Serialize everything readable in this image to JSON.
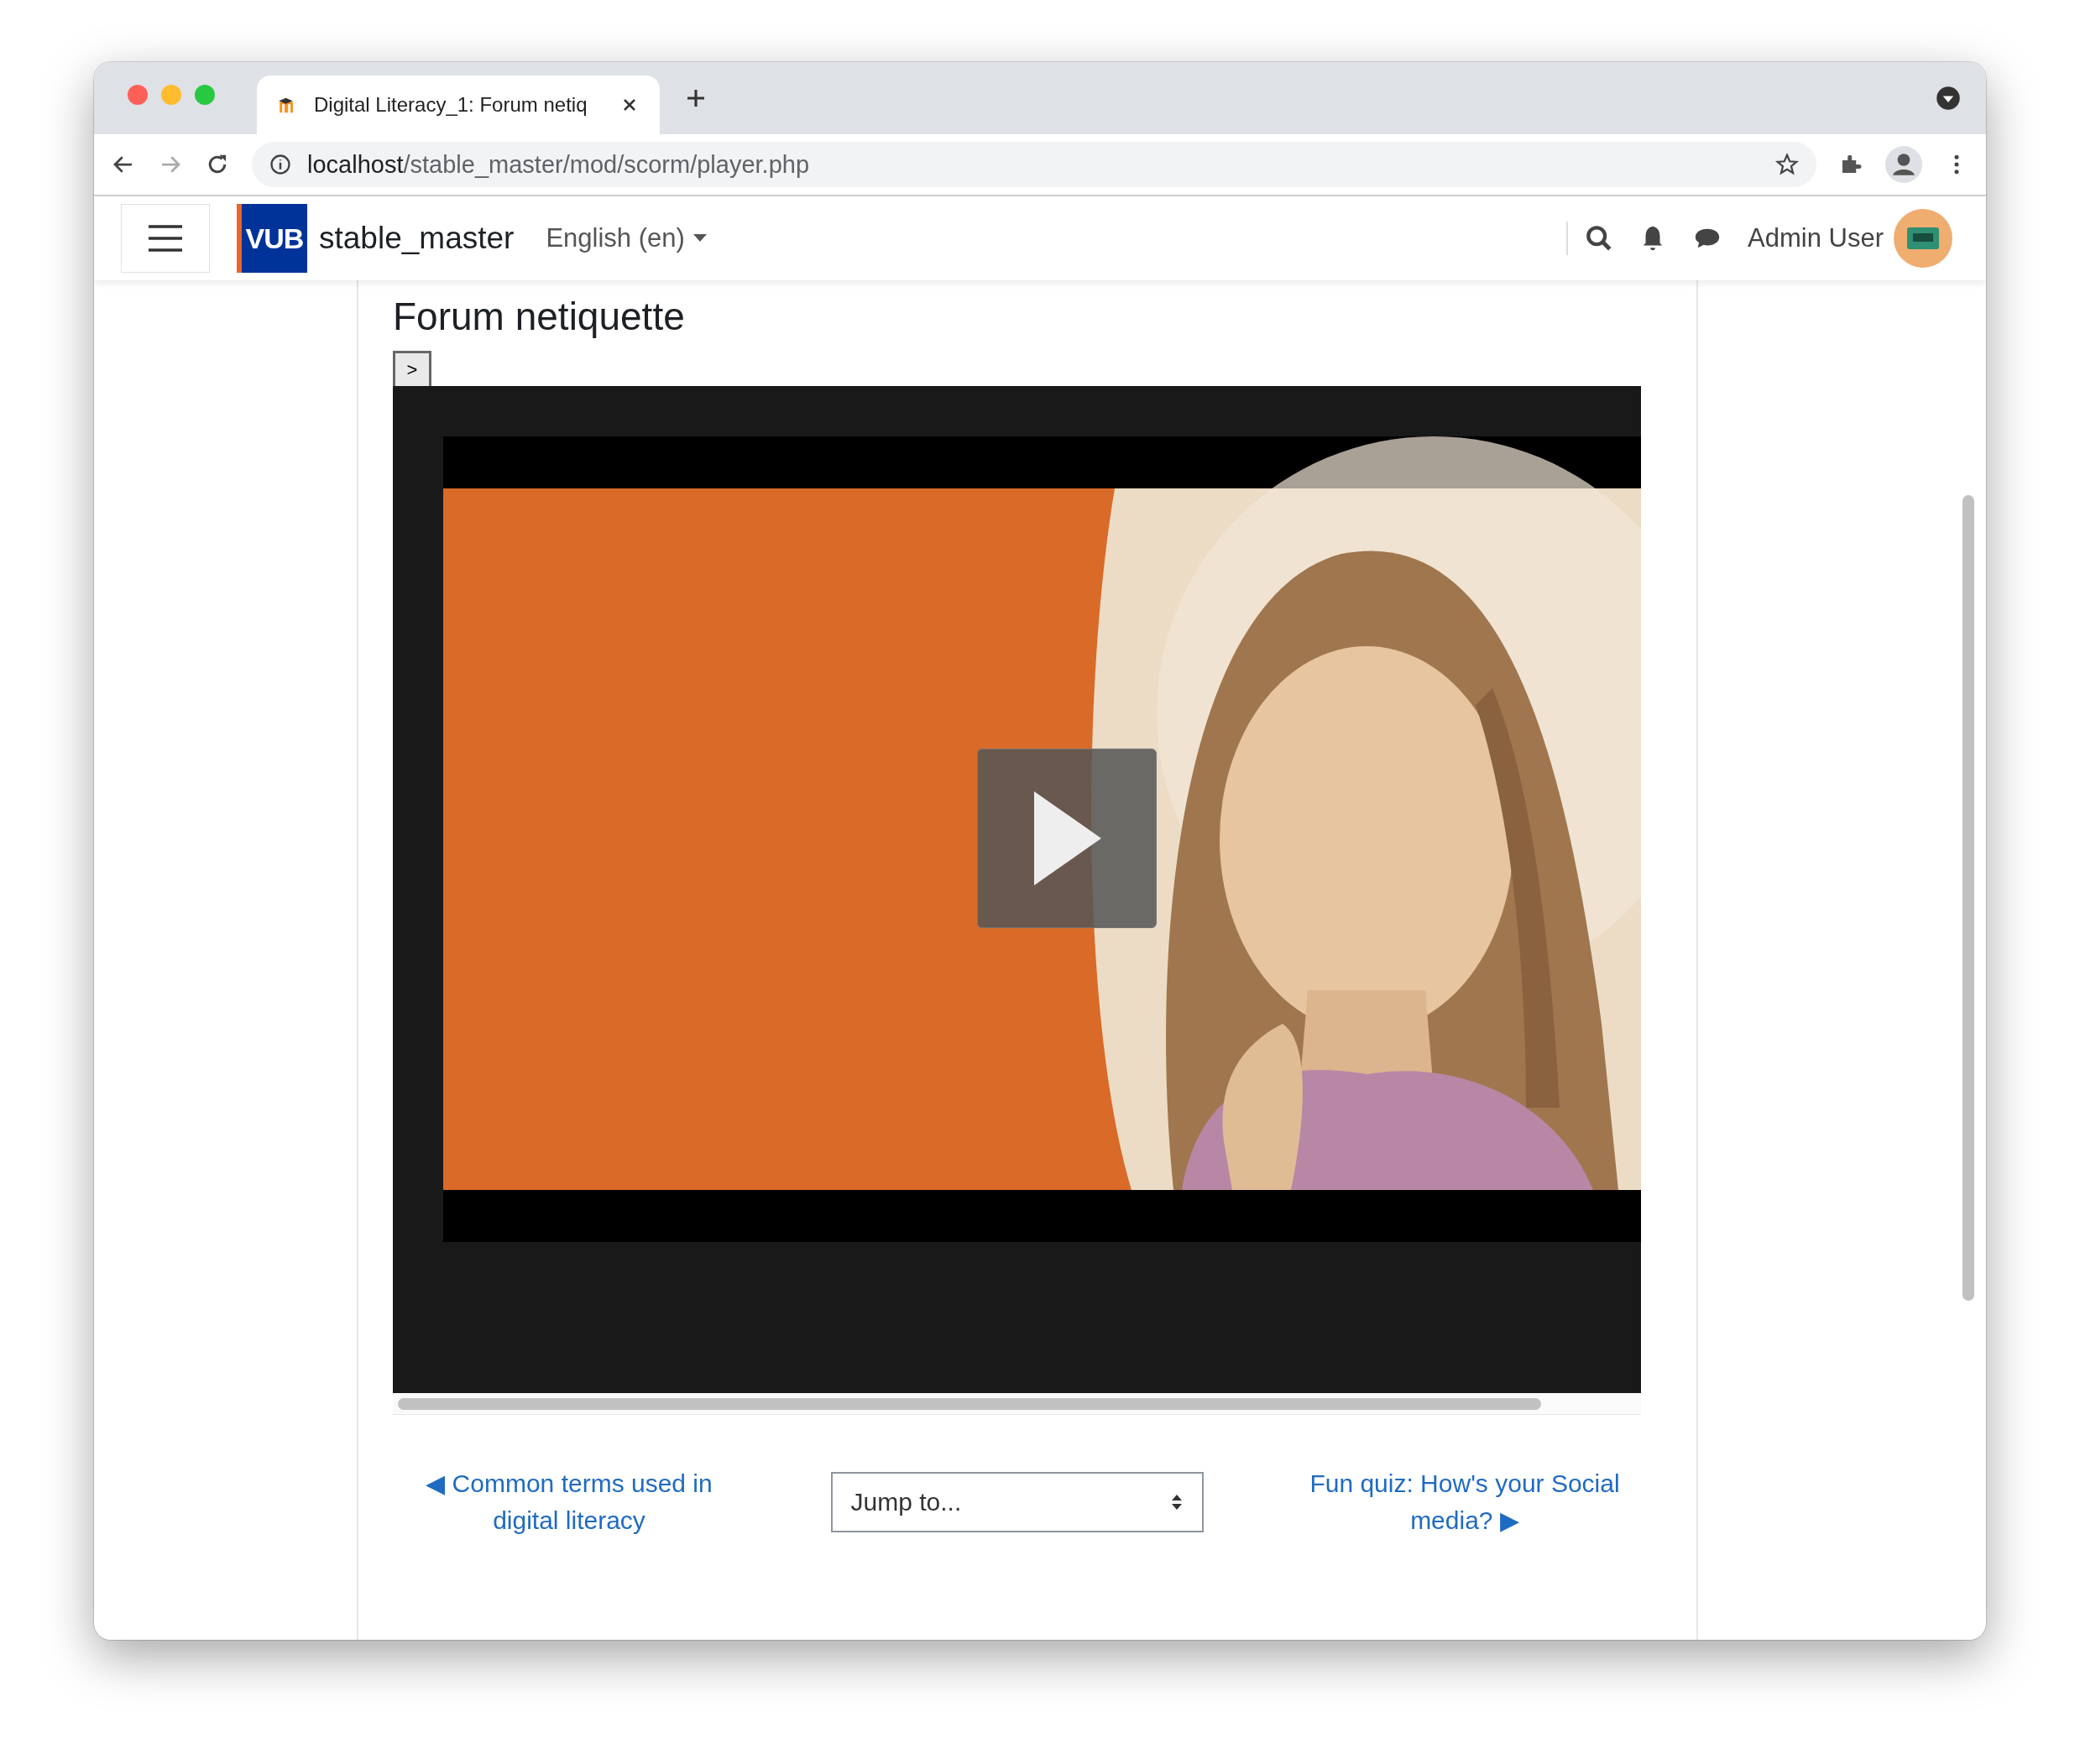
{
  "browser": {
    "tabs": [
      {
        "title": "Digital Literacy_1: Forum netiq",
        "selected": true
      }
    ],
    "url": {
      "host": "localhost",
      "path": "/stable_master/mod/scorm/player.php"
    }
  },
  "navbar": {
    "logo_text": "VUB",
    "site_name": "stable_master",
    "language": "English (en)",
    "user_name": "Admin User"
  },
  "page": {
    "heading": "Forum netiquette",
    "toc_toggle": ">"
  },
  "navigation": {
    "previous": "◀ Common terms used in digital literacy",
    "jump": {
      "value": "Jump to..."
    },
    "next": "Fun quiz: How's your Social media? ▶"
  }
}
